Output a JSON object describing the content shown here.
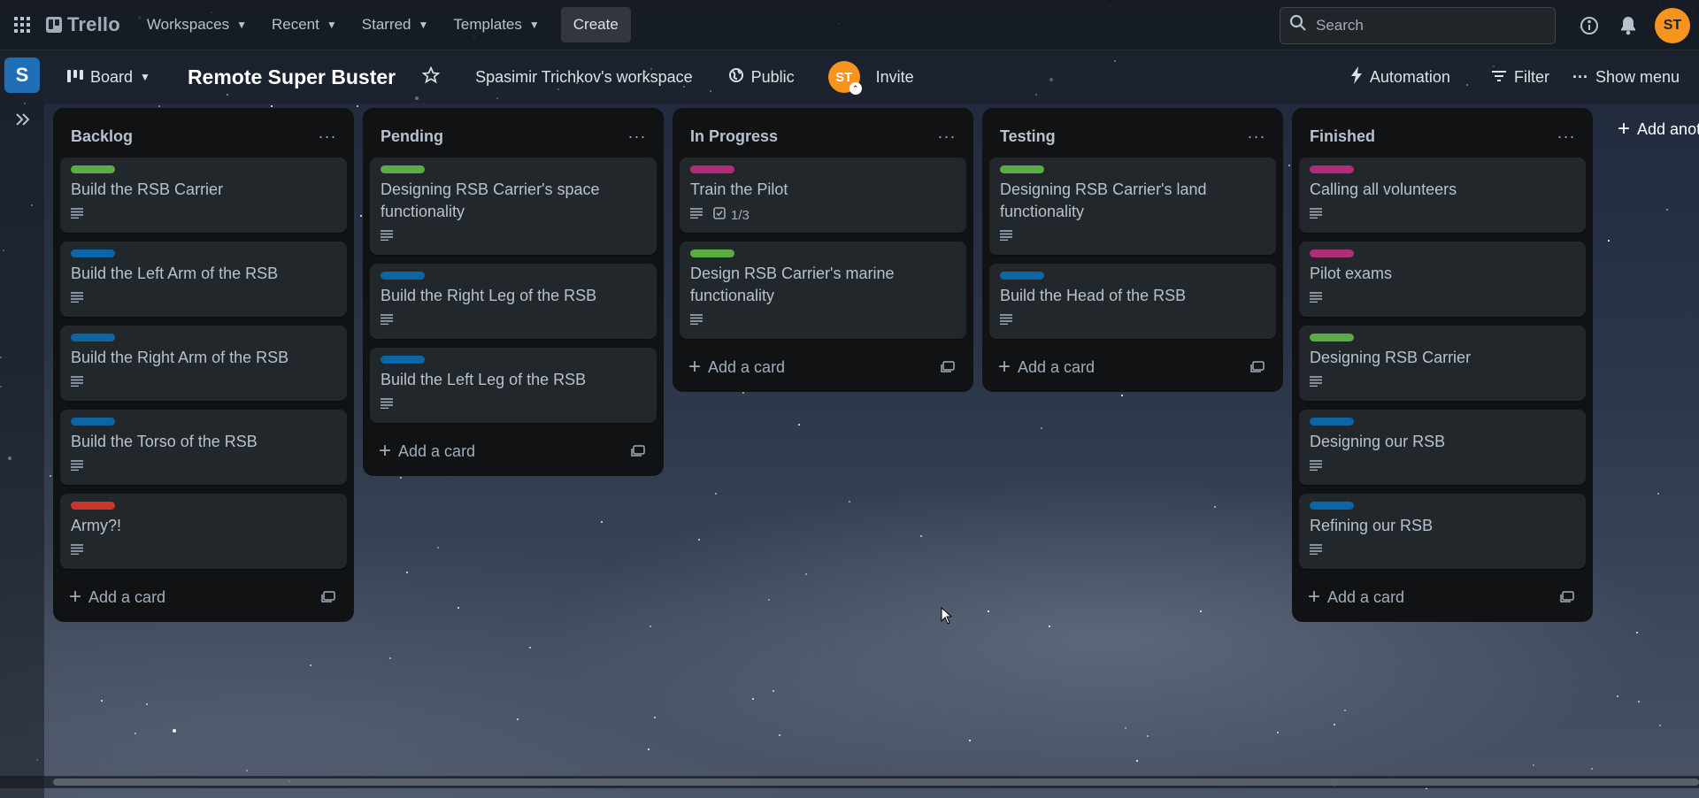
{
  "topnav": {
    "apps_icon": "apps-grid-icon",
    "logo_text": "Trello",
    "menus": [
      {
        "label": "Workspaces"
      },
      {
        "label": "Recent"
      },
      {
        "label": "Starred"
      },
      {
        "label": "Templates"
      }
    ],
    "create_label": "Create",
    "search_placeholder": "Search",
    "user_initials": "ST"
  },
  "sidebar": {
    "workspace_initial": "S"
  },
  "board_header": {
    "view_label": "Board",
    "title": "Remote Super Buster",
    "workspace_label": "Spasimir Trichkov's workspace",
    "visibility_label": "Public",
    "member_initials": "ST",
    "invite_label": "Invite",
    "automation_label": "Automation",
    "filter_label": "Filter",
    "show_menu_label": "Show menu"
  },
  "label_colors": {
    "green": "#5aac44",
    "blue": "#0c66a4",
    "magenta": "#ae2e78",
    "red": "#c9372c"
  },
  "lists": [
    {
      "title": "Backlog",
      "cards": [
        {
          "label": "green",
          "title": "Build the RSB Carrier"
        },
        {
          "label": "blue",
          "title": "Build the Left Arm of the RSB"
        },
        {
          "label": "blue",
          "title": "Build the Right Arm of the RSB"
        },
        {
          "label": "blue",
          "title": "Build the Torso of the RSB"
        },
        {
          "label": "red",
          "title": "Army?!"
        }
      ]
    },
    {
      "title": "Pending",
      "cards": [
        {
          "label": "green",
          "title": "Designing RSB Carrier's space functionality"
        },
        {
          "label": "blue",
          "title": "Build the Right Leg of the RSB"
        },
        {
          "label": "blue",
          "title": "Build the Left Leg of the RSB"
        }
      ]
    },
    {
      "title": "In Progress",
      "cards": [
        {
          "label": "magenta",
          "title": "Train the Pilot",
          "checklist": "1/3"
        },
        {
          "label": "green",
          "title": "Design RSB Carrier's marine functionality"
        }
      ]
    },
    {
      "title": "Testing",
      "cards": [
        {
          "label": "green",
          "title": "Designing RSB Carrier's land functionality"
        },
        {
          "label": "blue",
          "title": "Build the Head of the RSB"
        }
      ]
    },
    {
      "title": "Finished",
      "cards": [
        {
          "label": "magenta",
          "title": "Calling all volunteers"
        },
        {
          "label": "magenta",
          "title": "Pilot exams"
        },
        {
          "label": "green",
          "title": "Designing RSB Carrier"
        },
        {
          "label": "blue",
          "title": "Designing our RSB"
        },
        {
          "label": "blue",
          "title": "Refining our RSB"
        }
      ]
    }
  ],
  "add_card_label": "Add a card",
  "add_list_label": "Add another list"
}
